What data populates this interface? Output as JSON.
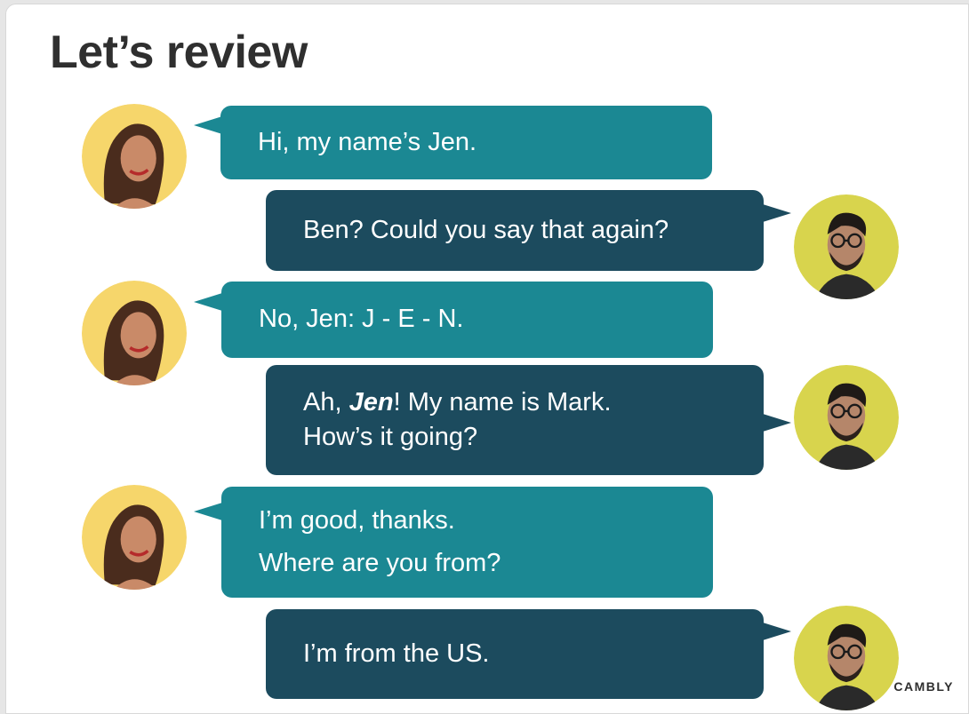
{
  "slide": {
    "title": "Let’s review",
    "brand": "CAMBLY"
  },
  "conversation": [
    {
      "speaker": "jen",
      "lines": [
        "Hi, my name’s Jen."
      ]
    },
    {
      "speaker": "mark",
      "lines": [
        "Ben? Could you say that again?"
      ]
    },
    {
      "speaker": "jen",
      "lines": [
        "No, Jen: J - E - N."
      ]
    },
    {
      "speaker": "mark",
      "lines": [
        "Ah, ",
        "Jen",
        "! My name is Mark.",
        "How’s it going?"
      ]
    },
    {
      "speaker": "jen",
      "lines": [
        "I’m good, thanks.",
        "Where are you from?"
      ]
    },
    {
      "speaker": "mark",
      "lines": [
        "I’m from the US."
      ]
    }
  ],
  "colors": {
    "jen_bubble": "#1b8893",
    "mark_bubble": "#1c4b5e",
    "jen_avatar_bg": "#f6d66b",
    "mark_avatar_bg": "#d8d44d"
  },
  "icons": {
    "jen": "woman-avatar-icon",
    "mark": "man-avatar-icon"
  }
}
